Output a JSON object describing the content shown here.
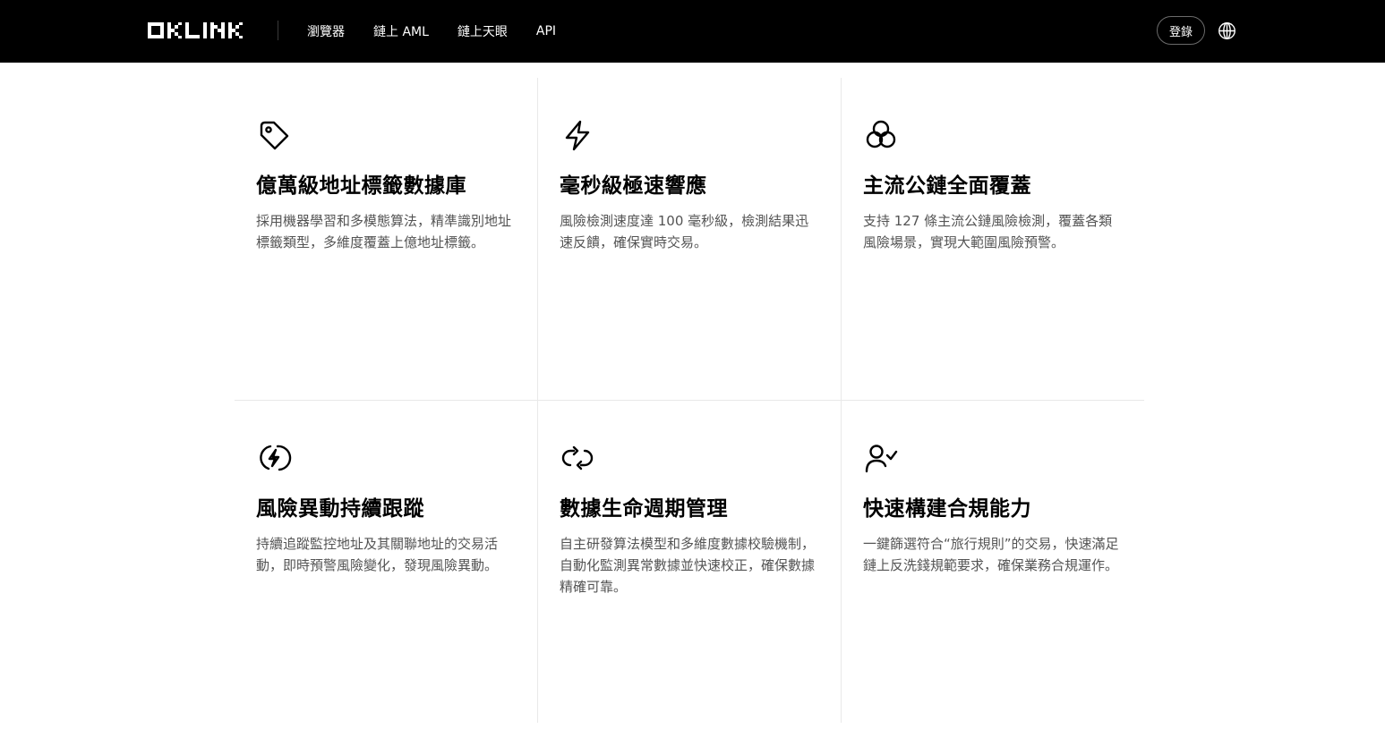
{
  "header": {
    "logo_text": "OKLINK",
    "nav": [
      {
        "label": "瀏覽器"
      },
      {
        "label": "鏈上 AML"
      },
      {
        "label": "鏈上天眼"
      },
      {
        "label": "API"
      }
    ],
    "login_label": "登錄",
    "language_icon": "globe-icon"
  },
  "features": [
    {
      "icon": "tag-icon",
      "title": "億萬級地址標籤數據庫",
      "description": "採用機器學習和多模態算法，精準識別地址標籤類型，多維度覆蓋上億地址標籤。"
    },
    {
      "icon": "lightning-icon",
      "title": "毫秒級極速響應",
      "description": "風險檢測速度達 100 毫秒級，檢測結果迅速反饋，確保實時交易。"
    },
    {
      "icon": "circles-icon",
      "title": "主流公鏈全面覆蓋",
      "description": "支持 127 條主流公鏈風險檢測，覆蓋各類風險場景，實現大範圍風險預警。"
    },
    {
      "icon": "lightning-circle-icon",
      "title": "風險異動持續跟蹤",
      "description": "持續追蹤監控地址及其關聯地址的交易活動，即時預警風險變化，發現風險異動。"
    },
    {
      "icon": "refresh-icon",
      "title": "數據生命週期管理",
      "description": "自主研發算法模型和多維度數據校驗機制，自動化監測異常數據並快速校正，確保數據精確可靠。"
    },
    {
      "icon": "user-check-icon",
      "title": "快速構建合規能力",
      "description": "一鍵篩選符合“旅行規則”的交易，快速滿足鏈上反洗錢規範要求，確保業務合規運作。"
    }
  ]
}
